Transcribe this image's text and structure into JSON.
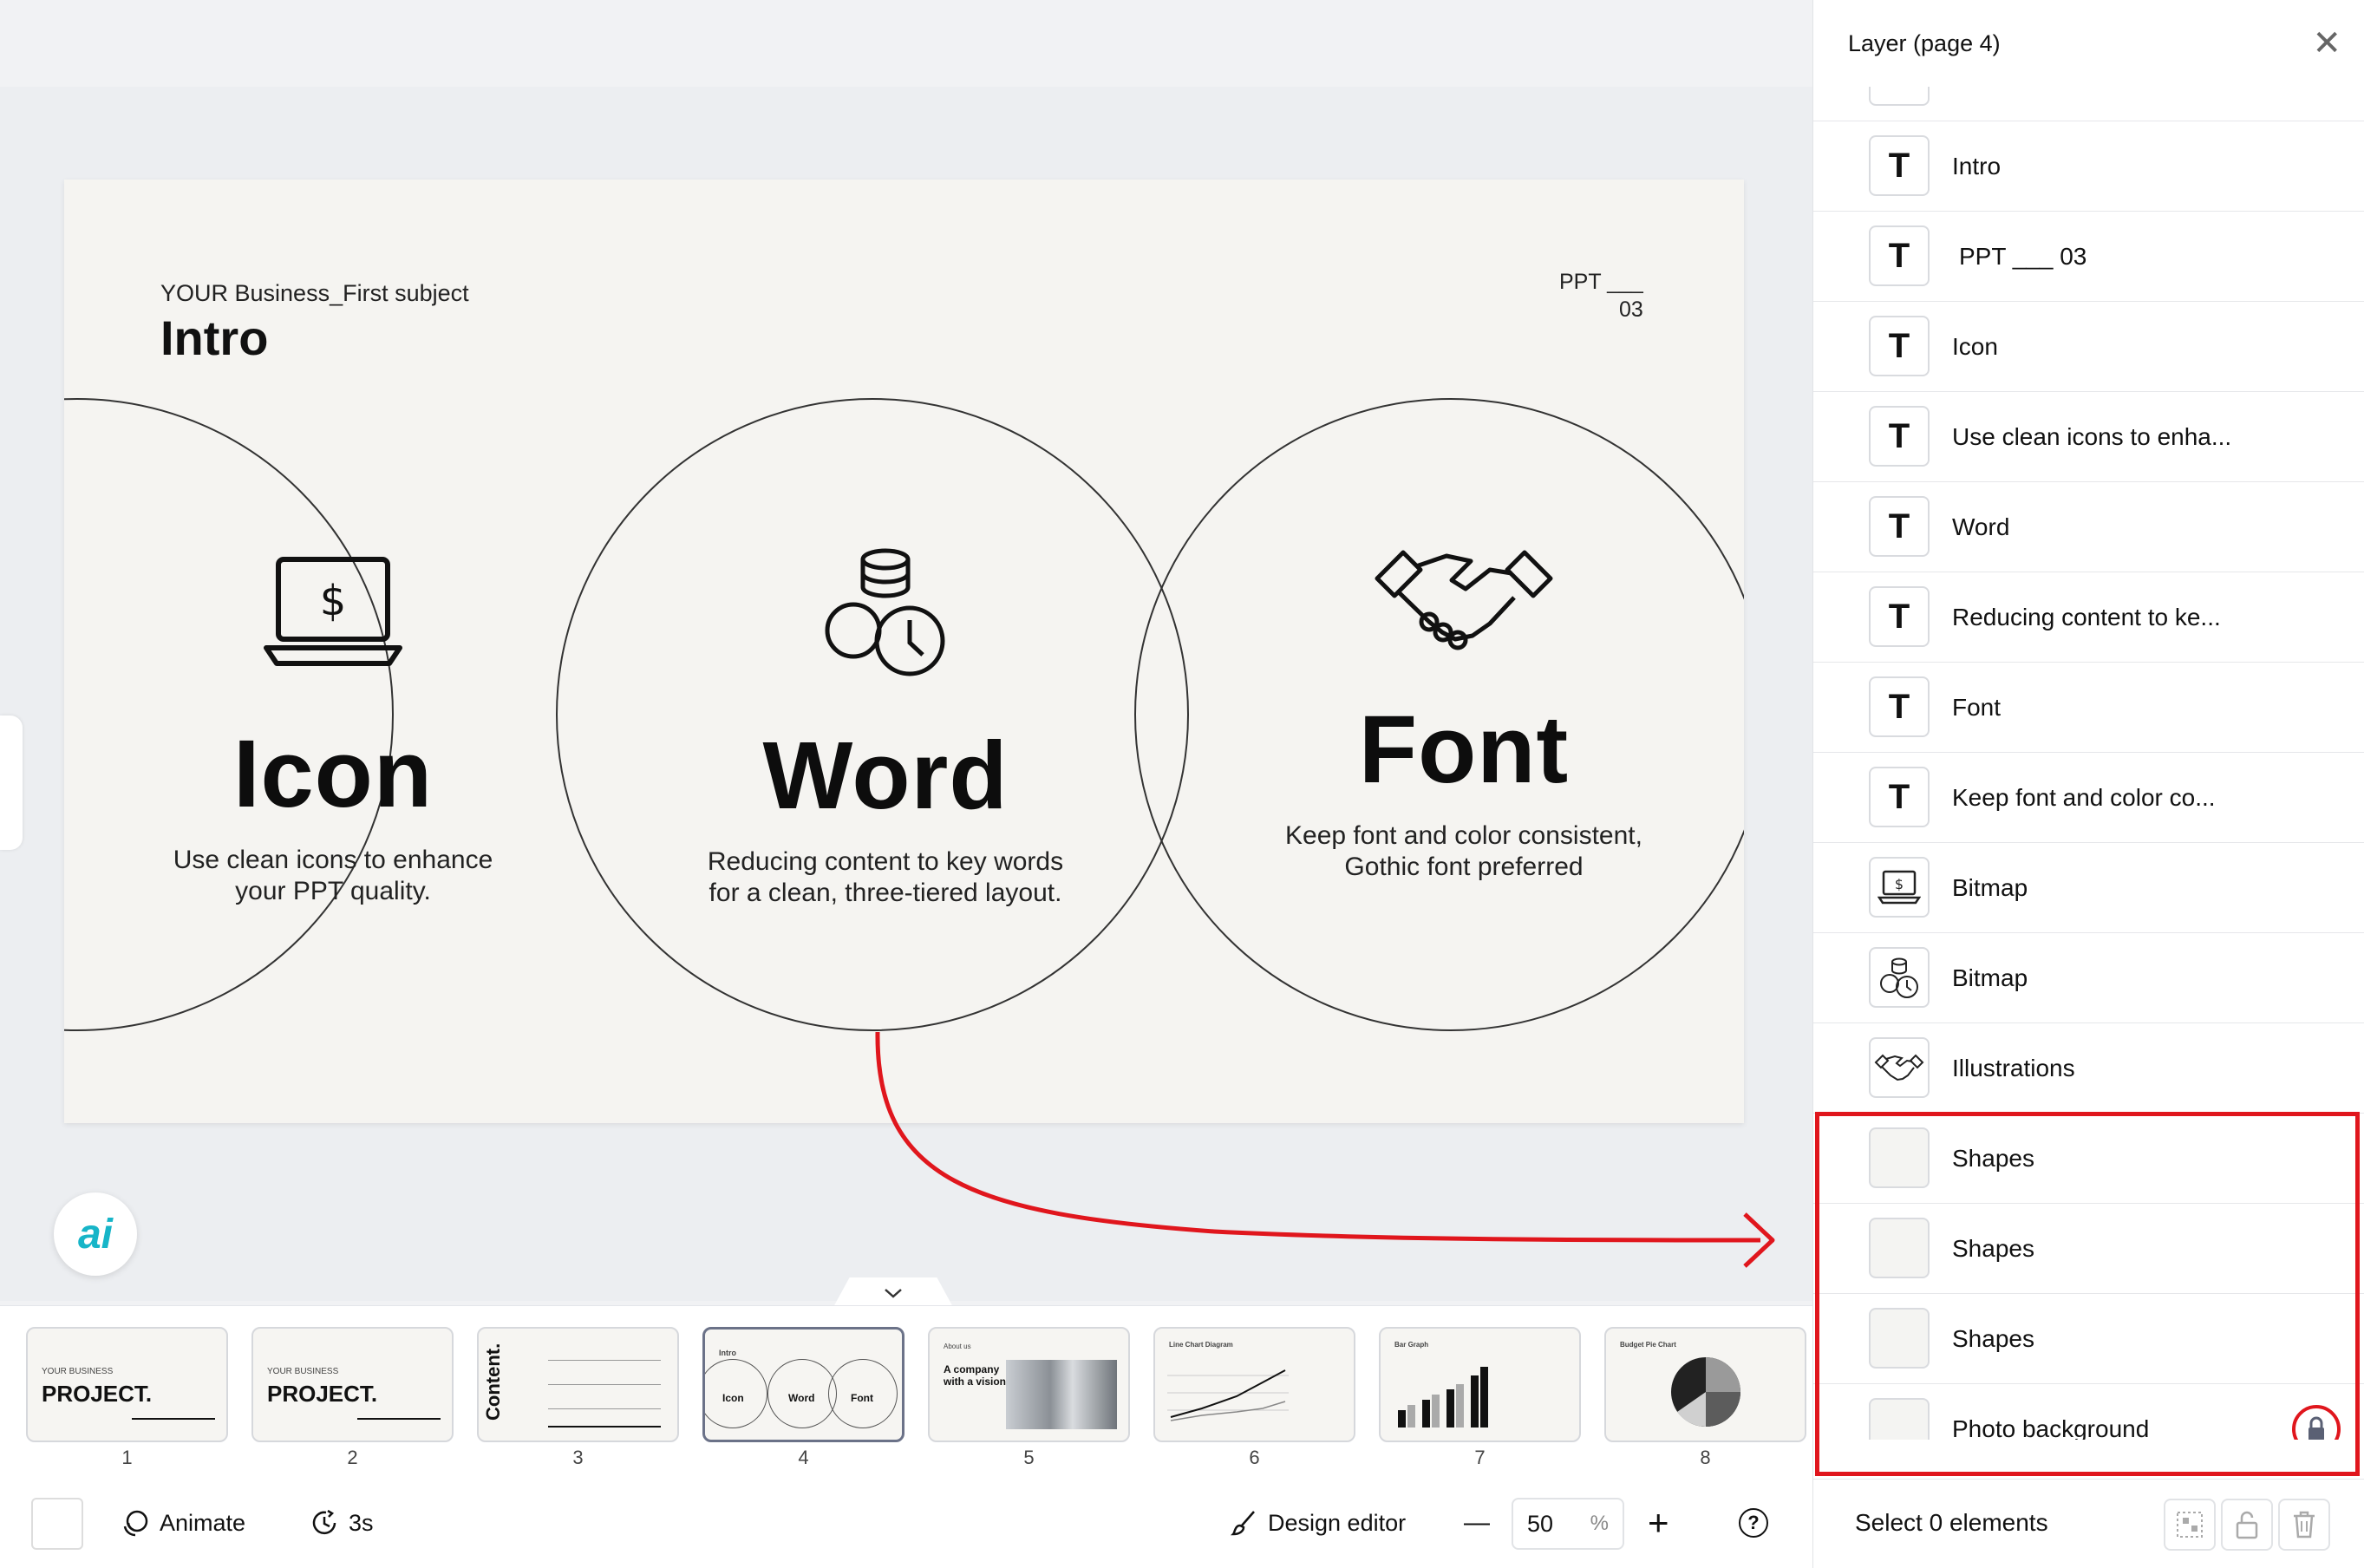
{
  "panel": {
    "title": "Layer (page 4)",
    "layers": [
      {
        "label": "",
        "type": "text"
      },
      {
        "label": "Intro",
        "type": "text"
      },
      {
        "label": "PPT ___ 03",
        "type": "text"
      },
      {
        "label": "Icon",
        "type": "text"
      },
      {
        "label": "Use clean icons to enha...",
        "type": "text"
      },
      {
        "label": "Word",
        "type": "text"
      },
      {
        "label": "Reducing content to ke...",
        "type": "text"
      },
      {
        "label": "Font",
        "type": "text"
      },
      {
        "label": "Keep font and color co...",
        "type": "text"
      },
      {
        "label": "Bitmap",
        "type": "laptop"
      },
      {
        "label": "Bitmap",
        "type": "coins"
      },
      {
        "label": "Illustrations",
        "type": "handshake"
      },
      {
        "label": "Shapes",
        "type": "shape"
      },
      {
        "label": "Shapes",
        "type": "shape"
      },
      {
        "label": "Shapes",
        "type": "shape"
      },
      {
        "label": "Photo background",
        "type": "background",
        "locked": true
      }
    ],
    "footer_label": "Select 0 elements"
  },
  "slide": {
    "subtitle": "YOUR Business_First subject",
    "title": "Intro",
    "ppt_label": "PPT ___",
    "ppt_number": "03",
    "columns": [
      {
        "heading": "Icon",
        "line1": "Use clean icons to enhance",
        "line2": "your PPT quality."
      },
      {
        "heading": "Word",
        "line1": "Reducing content to key words",
        "line2": "for a clean, three-tiered layout."
      },
      {
        "heading": "Font",
        "line1": "Keep font and color consistent,",
        "line2": "Gothic font preferred"
      }
    ]
  },
  "ai_button": "ai",
  "thumbnails": [
    {
      "num": "1",
      "title": "PROJECT.",
      "sub": "YOUR BUSINESS"
    },
    {
      "num": "2",
      "title": "PROJECT.",
      "sub": "YOUR BUSINESS"
    },
    {
      "num": "3",
      "title": "Content.",
      "sub": ""
    },
    {
      "num": "4",
      "title": "",
      "sub": "Intro",
      "items": [
        "Icon",
        "Word",
        "Font"
      ]
    },
    {
      "num": "5",
      "title": "A company with a vision",
      "sub": "About us"
    },
    {
      "num": "6",
      "title": "",
      "sub": "Line Chart Diagram"
    },
    {
      "num": "7",
      "title": "",
      "sub": "Bar Graph"
    },
    {
      "num": "8",
      "title": "",
      "sub": "Budget Pie Chart"
    }
  ],
  "toolbar": {
    "animate": "Animate",
    "duration": "3s",
    "design_editor": "Design editor",
    "zoom_minus": "—",
    "zoom_value": "50",
    "zoom_unit": "%",
    "zoom_plus": "+",
    "help": "?"
  },
  "colors": {
    "highlight": "#e0161d",
    "accent_ai": "#17b5c8"
  }
}
